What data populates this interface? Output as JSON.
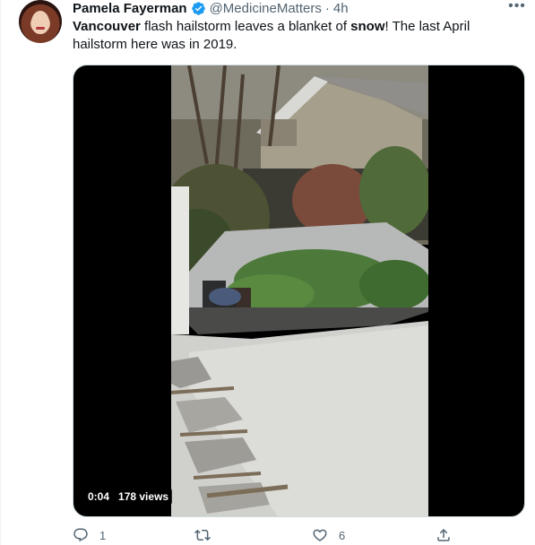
{
  "author": {
    "name": "Pamela Fayerman",
    "handle": "@MedicineMatters",
    "separator": "·",
    "time": "4h"
  },
  "tweet": {
    "bold_1": "Vancouver",
    "text_1": " flash hailstorm leaves a blanket of ",
    "bold_2": "snow",
    "text_2": "! The last April hailstorm here was in 2019."
  },
  "video": {
    "timestamp": "0:04",
    "views": "178 views"
  },
  "actions": {
    "reply_count": "1",
    "retweet_count": "",
    "like_count": "6"
  },
  "colors": {
    "verified": "#1d9bf0",
    "secondary_text": "#536471"
  },
  "icons": [
    "verified-badge-icon",
    "more-icon",
    "reply-icon",
    "retweet-icon",
    "like-icon",
    "share-icon"
  ]
}
